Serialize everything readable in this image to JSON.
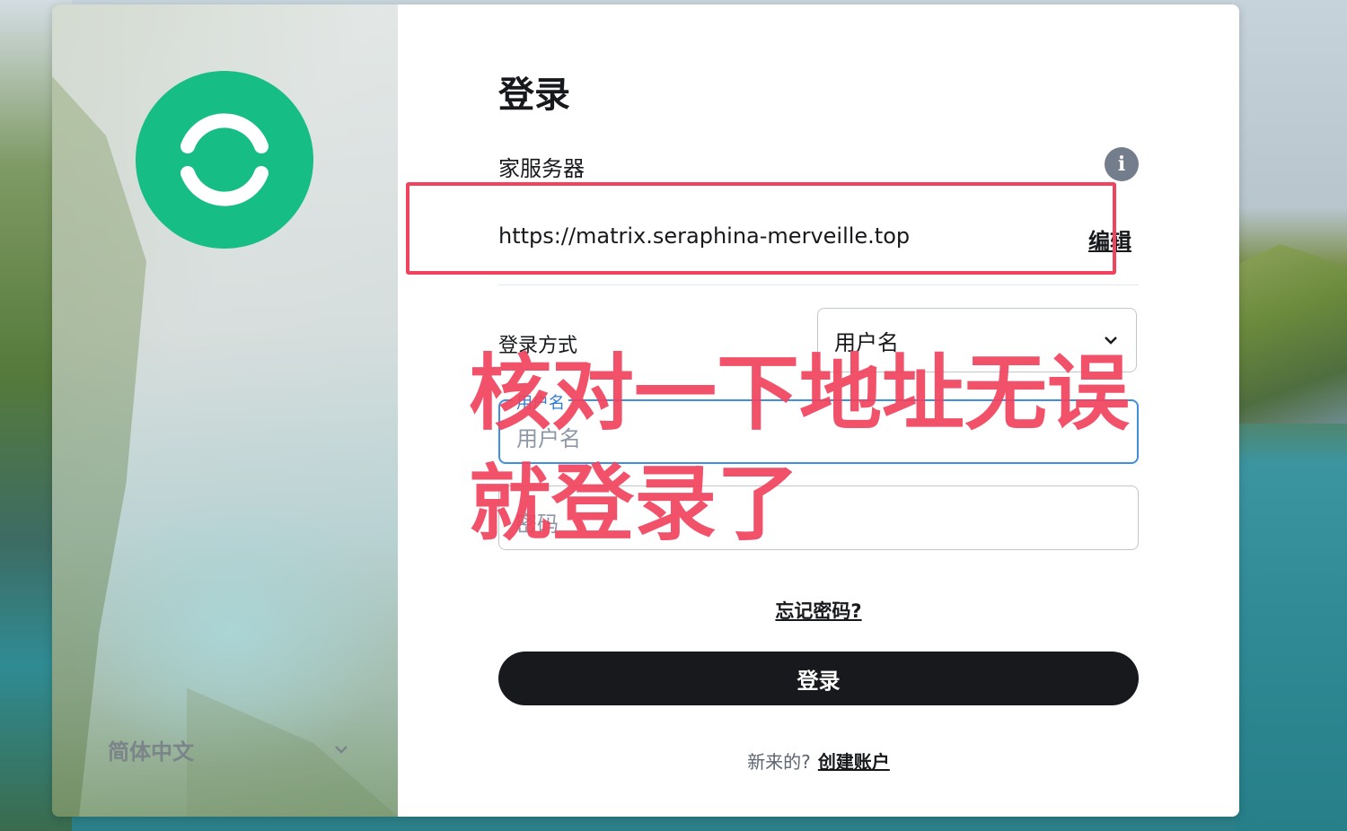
{
  "login": {
    "title": "登录",
    "homeserver": {
      "label": "家服务器",
      "url": "https://matrix.seraphina-merveille.top",
      "edit_label": "编辑",
      "info_icon": "info-icon"
    },
    "method": {
      "label": "登录方式",
      "selected": "用户名"
    },
    "username": {
      "legend": "用户名",
      "placeholder": "用户名"
    },
    "password": {
      "placeholder": "密码"
    },
    "forgot_label": "忘记密码?",
    "submit_label": "登录",
    "footer": {
      "prompt": "新来的?",
      "create_label": "创建账户"
    }
  },
  "sidebar": {
    "language": "简体中文"
  },
  "annotation": {
    "line1": "核对一下地址无误",
    "line2": "就登录了"
  },
  "colors": {
    "brand": "#16bd85",
    "annotation": "#f0445e",
    "button": "#17191c",
    "focus": "#3f8ee0"
  }
}
